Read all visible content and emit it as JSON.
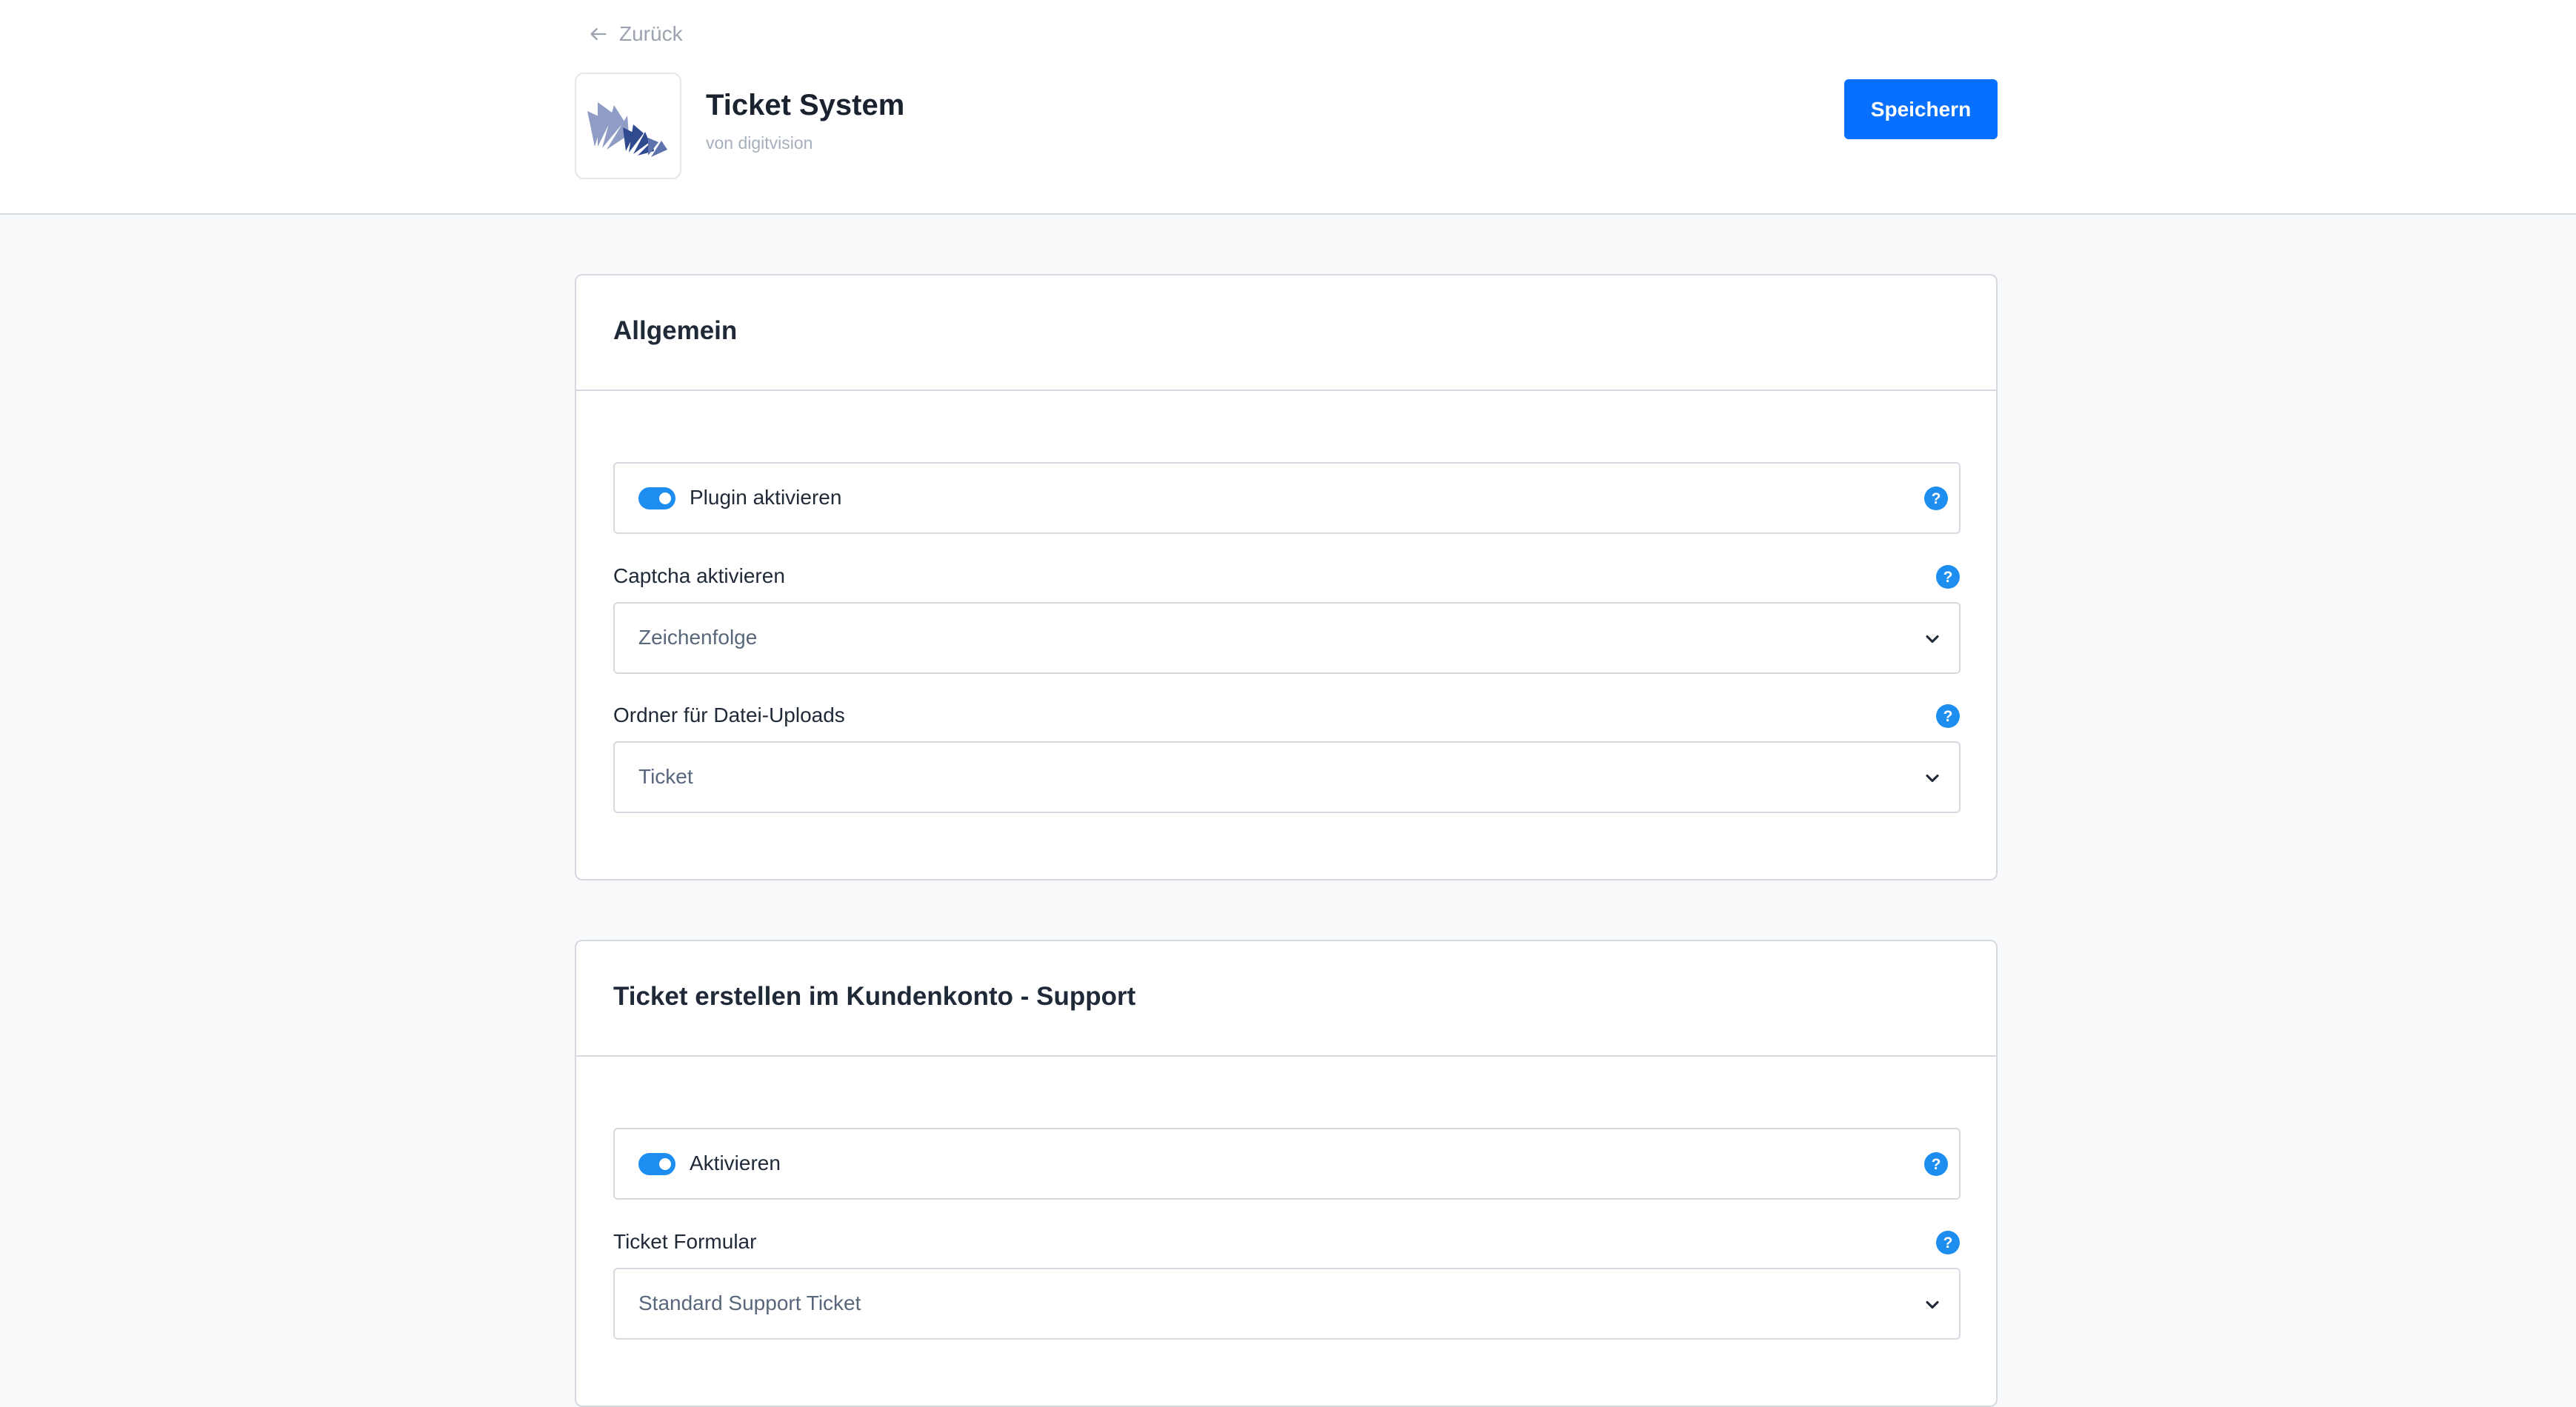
{
  "header": {
    "back_label": "Zurück",
    "app_title": "Ticket System",
    "vendor": "von digitvision",
    "save_label": "Speichern"
  },
  "colors": {
    "accent": "#0870ff",
    "toggle_on": "#1d8df0",
    "border": "#d6dae0",
    "page_background": "#f8f9fb"
  },
  "sections": [
    {
      "title": "Allgemein",
      "toggle": {
        "label": "Plugin aktivieren",
        "enabled": true
      },
      "fields": [
        {
          "label": "Captcha aktivieren",
          "value": "Zeichenfolge"
        },
        {
          "label": "Ordner für Datei-Uploads",
          "value": "Ticket"
        }
      ]
    },
    {
      "title": "Ticket erstellen im Kundenkonto - Support",
      "toggle": {
        "label": "Aktivieren",
        "enabled": true
      },
      "fields": [
        {
          "label": "Ticket Formular",
          "value": "Standard Support Ticket"
        }
      ]
    }
  ],
  "icons": {
    "back": "arrow-left-icon",
    "help": "question-circle-icon",
    "dropdown": "chevron-down-icon",
    "logo": "digitvision-logo"
  },
  "help_glyph": "?"
}
